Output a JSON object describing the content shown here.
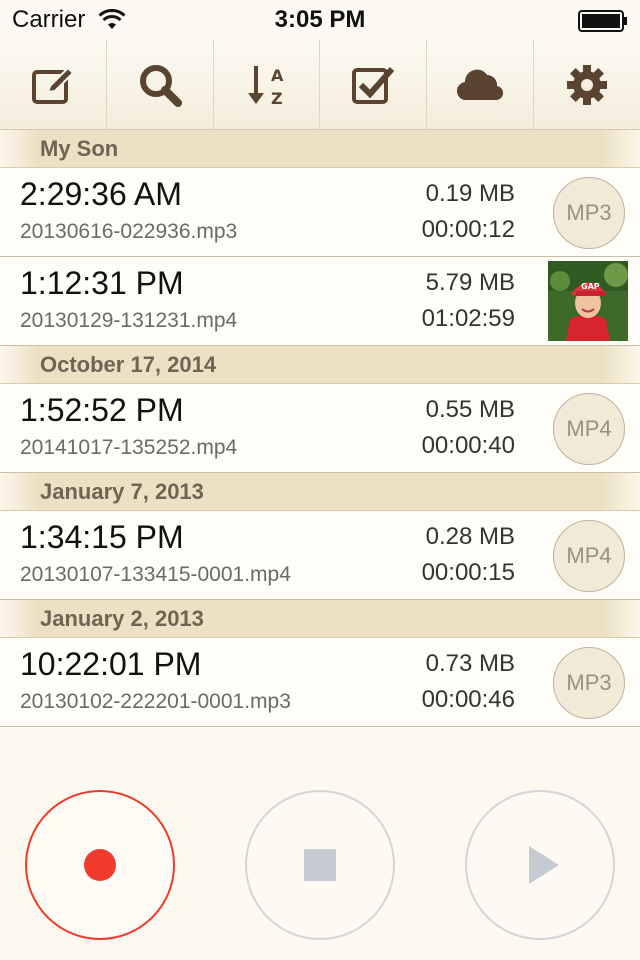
{
  "status_bar": {
    "carrier": "Carrier",
    "time": "3:05 PM",
    "wifi_icon": "wifi-icon",
    "battery_icon": "battery-full-icon"
  },
  "toolbar": {
    "items": [
      {
        "name": "edit",
        "icon": "pencil-edit-icon"
      },
      {
        "name": "search",
        "icon": "search-icon"
      },
      {
        "name": "sort",
        "icon": "sort-az-icon"
      },
      {
        "name": "select",
        "icon": "checkbox-icon"
      },
      {
        "name": "cloud",
        "icon": "cloud-icon"
      },
      {
        "name": "settings",
        "icon": "gear-icon"
      }
    ],
    "icon_color": "#5b4331"
  },
  "sections": [
    {
      "title": "My Son",
      "rows": [
        {
          "time": "2:29:36 AM",
          "file": "20130616-022936.mp3",
          "size": "0.19 MB",
          "duration": "00:00:12",
          "badge": "MP3"
        },
        {
          "time": "1:12:31 PM",
          "file": "20130129-131231.mp4",
          "size": "5.79 MB",
          "duration": "01:02:59",
          "thumbnail": true
        }
      ]
    },
    {
      "title": "October 17, 2014",
      "rows": [
        {
          "time": "1:52:52 PM",
          "file": "20141017-135252.mp4",
          "size": "0.55 MB",
          "duration": "00:00:40",
          "badge": "MP4"
        }
      ]
    },
    {
      "title": "January 7, 2013",
      "rows": [
        {
          "time": "1:34:15 PM",
          "file": "20130107-133415-0001.mp4",
          "size": "0.28 MB",
          "duration": "00:00:15",
          "badge": "MP4"
        }
      ]
    },
    {
      "title": "January 2, 2013",
      "rows": [
        {
          "time": "10:22:01 PM",
          "file": "20130102-222201-0001.mp3",
          "size": "0.73 MB",
          "duration": "00:00:46",
          "badge": "MP3"
        }
      ]
    }
  ],
  "controls": {
    "record_color": "#f23b2f",
    "disabled_color": "#c6cad1"
  }
}
